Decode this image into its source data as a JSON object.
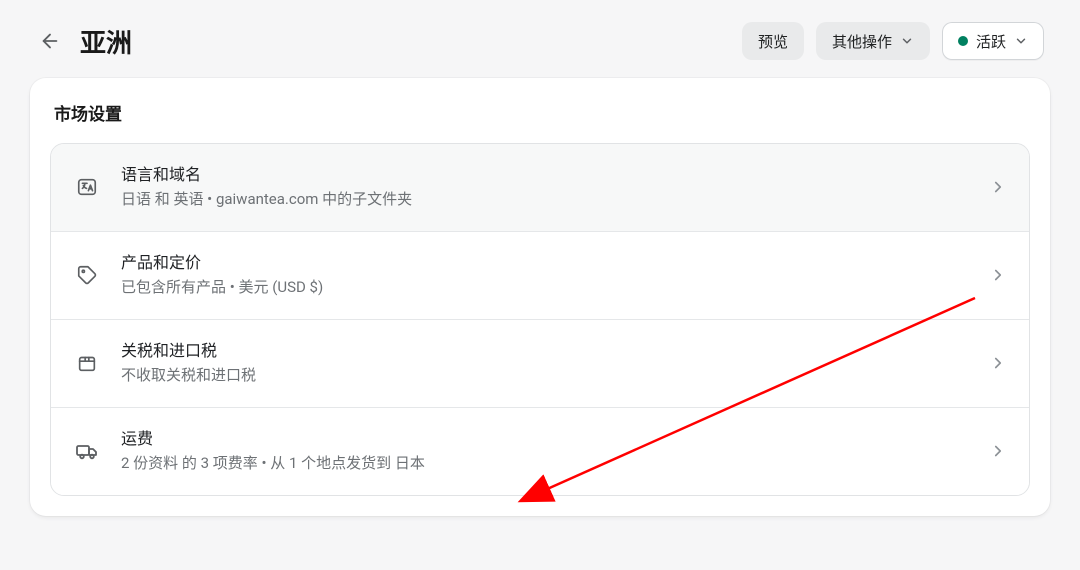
{
  "header": {
    "title": "亚洲",
    "preview_label": "预览",
    "more_actions_label": "其他操作",
    "status_label": "活跃",
    "status_color": "#008060"
  },
  "card": {
    "title": "市场设置",
    "items": [
      {
        "icon": "language-icon",
        "title": "语言和域名",
        "subtitle": "日语 和 英语 • gaiwantea.com 中的子文件夹"
      },
      {
        "icon": "pricetag-icon",
        "title": "产品和定价",
        "subtitle": "已包含所有产品 • 美元 (USD $)"
      },
      {
        "icon": "box-icon",
        "title": "关税和进口税",
        "subtitle": "不收取关税和进口税"
      },
      {
        "icon": "truck-icon",
        "title": "运费",
        "subtitle": "2 份资料 的 3 项费率 • 从 1 个地点发货到 日本"
      }
    ]
  }
}
